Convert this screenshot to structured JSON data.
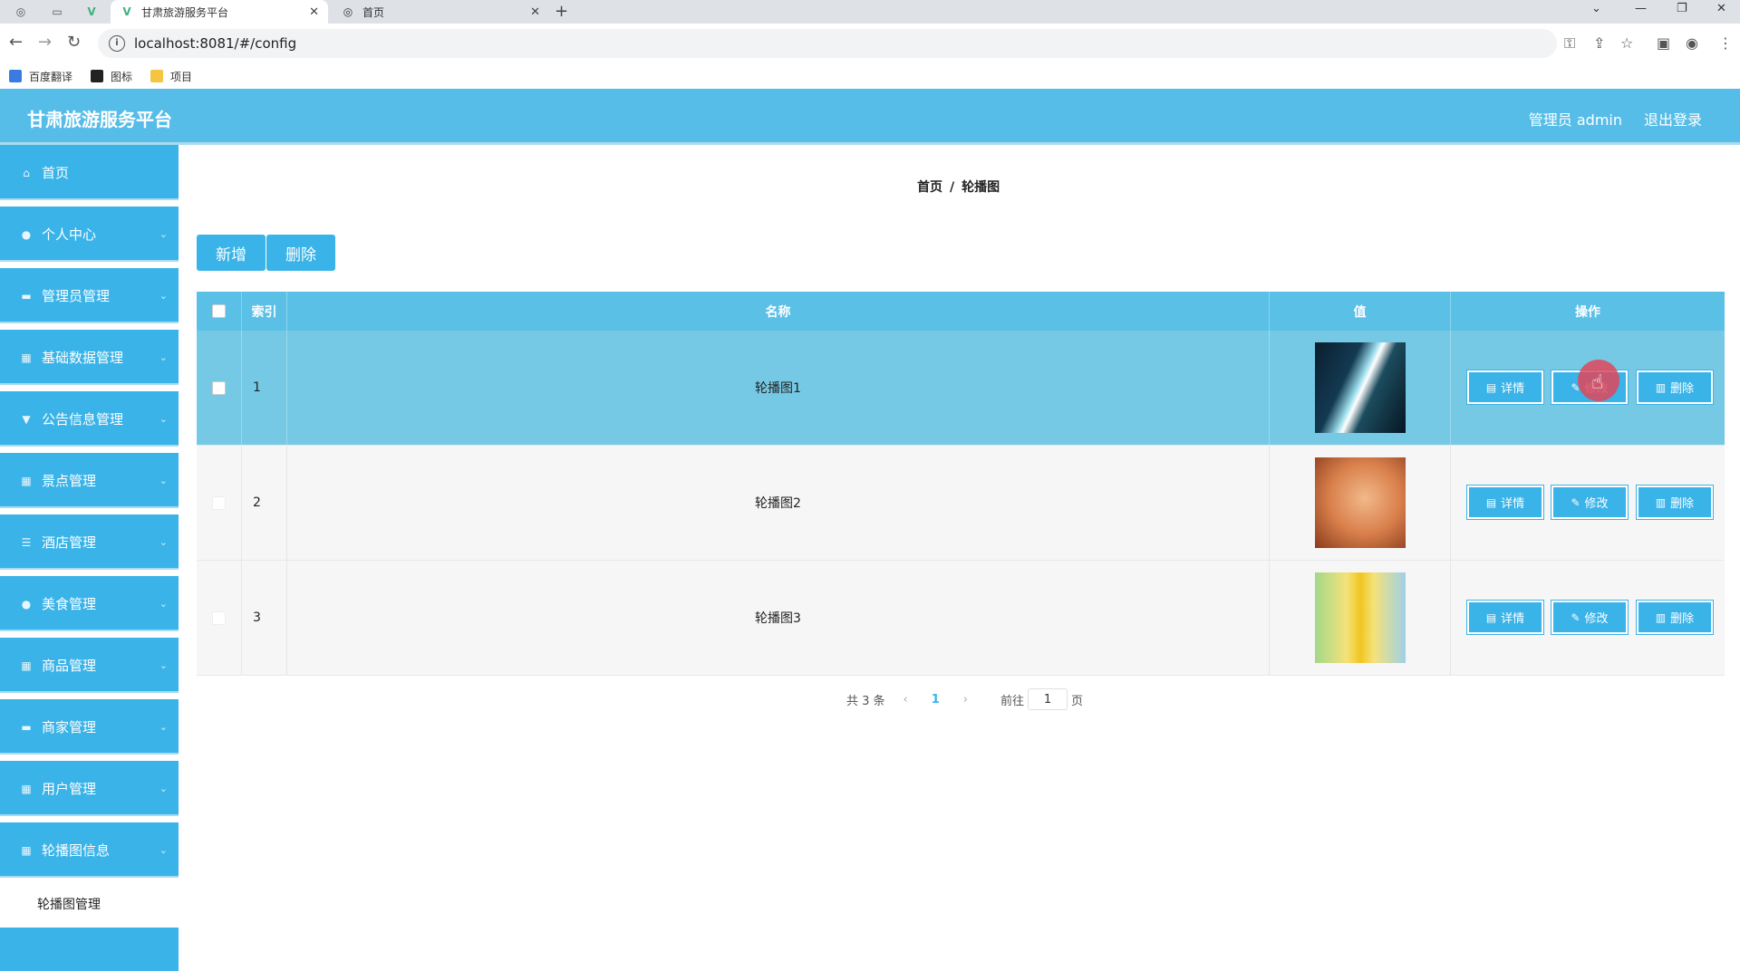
{
  "browser": {
    "tabs": [
      {
        "title": "甘肃旅游服务平台",
        "active": true
      },
      {
        "title": "首页",
        "active": false
      }
    ],
    "url": "localhost:8081/#/config",
    "bookmarks": [
      "百度翻译",
      "图标",
      "项目"
    ]
  },
  "header": {
    "title": "甘肃旅游服务平台",
    "user": "管理员 admin",
    "logout": "退出登录"
  },
  "sidebar": {
    "items": [
      {
        "label": "首页",
        "icon": "home-icon",
        "glyph": "⌂"
      },
      {
        "label": "个人中心",
        "icon": "user-icon",
        "glyph": "●"
      },
      {
        "label": "管理员管理",
        "icon": "admin-icon",
        "glyph": "▬"
      },
      {
        "label": "基础数据管理",
        "icon": "data-icon",
        "glyph": "▦"
      },
      {
        "label": "公告信息管理",
        "icon": "notice-icon",
        "glyph": "▼"
      },
      {
        "label": "景点管理",
        "icon": "grid-icon",
        "glyph": "▦"
      },
      {
        "label": "酒店管理",
        "icon": "list-icon",
        "glyph": "☰"
      },
      {
        "label": "美食管理",
        "icon": "location-icon",
        "glyph": "●"
      },
      {
        "label": "商品管理",
        "icon": "grid-icon",
        "glyph": "▦"
      },
      {
        "label": "商家管理",
        "icon": "shop-icon",
        "glyph": "▬"
      },
      {
        "label": "用户管理",
        "icon": "grid-icon",
        "glyph": "▦"
      },
      {
        "label": "轮播图信息",
        "icon": "grid-icon",
        "glyph": "▦"
      }
    ],
    "submenu": "轮播图管理"
  },
  "breadcrumb": {
    "home": "首页",
    "sep": "/",
    "current": "轮播图"
  },
  "toolbar": {
    "add": "新增",
    "delete": "删除"
  },
  "table": {
    "headers": {
      "index": "索引",
      "name": "名称",
      "value": "值",
      "ops": "操作"
    },
    "rows": [
      {
        "index": "1",
        "name": "轮播图1"
      },
      {
        "index": "2",
        "name": "轮播图2"
      },
      {
        "index": "3",
        "name": "轮播图3"
      }
    ],
    "ops": {
      "detail": "详情",
      "edit": "修改",
      "delete": "删除"
    }
  },
  "pagination": {
    "total": "共 3 条",
    "current": "1",
    "goto": "前往",
    "page_input": "1",
    "page_unit": "页"
  },
  "colors": {
    "primary": "#3ab3e8",
    "header": "#56bde8",
    "row_highlight": "#75c9e5"
  }
}
